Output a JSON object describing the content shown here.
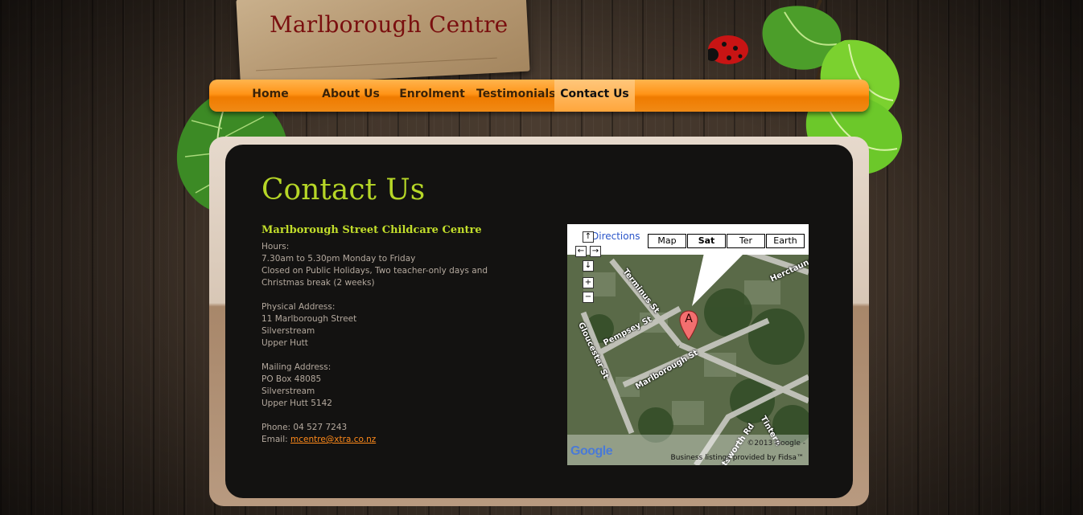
{
  "site": {
    "title": "Marlborough Centre"
  },
  "nav": {
    "items": [
      {
        "label": "Home"
      },
      {
        "label": "About Us"
      },
      {
        "label": "Enrolment"
      },
      {
        "label": "Testimonials"
      },
      {
        "label": "Contact Us"
      }
    ],
    "active": "Contact Us"
  },
  "page": {
    "heading": "Contact Us",
    "centre_name": "Marlborough Street Childcare Centre",
    "hours_label": "Hours:",
    "hours_line1": "7.30am to 5.30pm Monday to Friday",
    "hours_line2": "Closed on Public Holidays, Two teacher-only days and Christmas break (2 weeks)",
    "physical_label": "Physical Address:",
    "physical_lines": [
      "11 Marlborough Street",
      "Silverstream",
      "Upper Hutt"
    ],
    "mailing_label": "Mailing Address:",
    "mailing_lines": [
      "PO Box 48085",
      "Silverstream",
      "Upper Hutt 5142"
    ],
    "phone": "Phone: 04 527 7243",
    "email_label": "Email: ",
    "email": "mcentre@xtra.co.nz"
  },
  "map": {
    "directions": "Directions",
    "types": [
      "Map",
      "Sat",
      "Ter",
      "Earth"
    ],
    "selected_type": "Sat",
    "marker": "A",
    "streets": [
      "Terminus St",
      "Pempsey St",
      "Gloucester St",
      "Marlborough St",
      "Herctaunga",
      "Tintern",
      "Chatsworth Rd"
    ],
    "logo": "Google",
    "copyright": "©2013 Google -",
    "business": "Business listings provided by Fidsa™",
    "controls": {
      "up": "↑",
      "left": "←",
      "right": "→",
      "down": "↓",
      "zoom_in": "+",
      "zoom_out": "−"
    }
  },
  "colors": {
    "accent_green": "#b6d627",
    "nav_orange": "#ff9417",
    "title_red": "#7a0f0f",
    "link_orange": "#ff8a1a"
  }
}
